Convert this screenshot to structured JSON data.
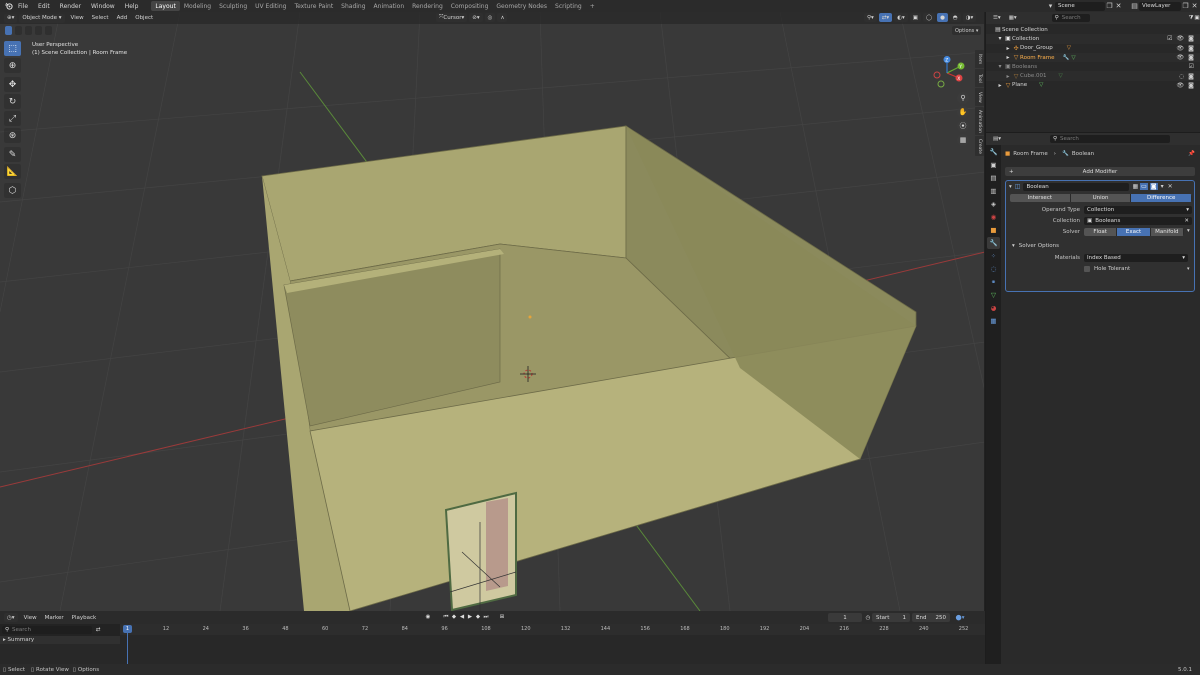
{
  "topbar": {
    "menus": [
      "File",
      "Edit",
      "Render",
      "Window",
      "Help"
    ],
    "workspaces": [
      "Layout",
      "Modeling",
      "Sculpting",
      "UV Editing",
      "Texture Paint",
      "Shading",
      "Animation",
      "Rendering",
      "Compositing",
      "Geometry Nodes",
      "Scripting"
    ],
    "active_workspace": "Layout",
    "add_tab": "+",
    "scene": "Scene",
    "view_layer": "ViewLayer"
  },
  "viewport": {
    "mode": "Object Mode",
    "menus": [
      "View",
      "Select",
      "Add",
      "Object"
    ],
    "pivot": "Cursor",
    "options": "Options",
    "overlay_line1": "User Perspective",
    "overlay_line2": "(1) Scene Collection | Room Frame",
    "side_tabs": [
      "Item",
      "Tool",
      "View",
      "Animation",
      "Create"
    ],
    "gizmo_axes": [
      "X",
      "Y",
      "Z"
    ]
  },
  "outliner": {
    "search_placeholder": "Search",
    "rows": [
      {
        "label": "Scene Collection",
        "icon": "scene-collection-icon"
      },
      {
        "label": "Collection",
        "icon": "collection-icon"
      },
      {
        "label": "Door_Group",
        "icon": "empty-icon"
      },
      {
        "label": "Room Frame",
        "icon": "mesh-object-icon"
      },
      {
        "label": "Booleans",
        "icon": "collection-icon"
      },
      {
        "label": "Cube.001",
        "icon": "mesh-object-icon"
      },
      {
        "label": "Plane",
        "icon": "mesh-object-icon"
      }
    ]
  },
  "properties": {
    "search_placeholder": "Search",
    "breadcrumb_object": "Room Frame",
    "breadcrumb_modifier": "Boolean",
    "add_modifier": "Add Modifier",
    "modifier_name": "Boolean",
    "operations": [
      "Intersect",
      "Union",
      "Difference"
    ],
    "active_operation": "Difference",
    "operand_type_label": "Operand Type",
    "operand_type_value": "Collection",
    "collection_label": "Collection",
    "collection_value": "Booleans",
    "solver_label": "Solver",
    "solvers": [
      "Float",
      "Exact",
      "Manifold"
    ],
    "active_solver": "Exact",
    "solver_options": "Solver Options",
    "materials_label": "Materials",
    "materials_value": "Index Based",
    "hole_tolerant": "Hole Tolerant"
  },
  "timeline": {
    "menus": [
      "View",
      "Marker",
      "Playback"
    ],
    "search_placeholder": "Search",
    "summary": "Summary",
    "current_frame": "1",
    "start_label": "Start",
    "start_value": "1",
    "end_label": "End",
    "end_value": "250",
    "ruler": [
      "1",
      "12",
      "24",
      "36",
      "48",
      "60",
      "72",
      "84",
      "96",
      "108",
      "120",
      "132",
      "144",
      "156",
      "168",
      "180",
      "192",
      "204",
      "216",
      "228",
      "240",
      "252"
    ]
  },
  "statusbar": {
    "select": "Select",
    "rotate_view": "Rotate View",
    "options": "Options",
    "version": "5.0.1"
  },
  "colors": {
    "accent": "#4772b3",
    "wall": "#a9a671",
    "grid_bg": "#393939"
  }
}
